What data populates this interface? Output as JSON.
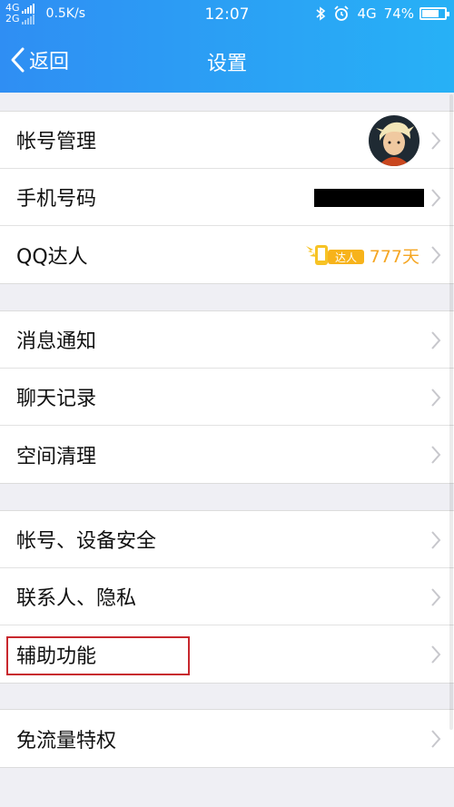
{
  "status_bar": {
    "net_top": "4G",
    "net_bottom": "2G",
    "speed": "0.5K/s",
    "time": "12:07",
    "network": "4G",
    "battery": "74%",
    "battery_level": 0.74,
    "icons": [
      "bluetooth-icon",
      "alarm-icon",
      "battery-icon"
    ]
  },
  "nav": {
    "back_label": "返回",
    "title": "设置"
  },
  "groups": [
    {
      "rows": [
        {
          "label": "帐号管理",
          "accessory": "avatar"
        },
        {
          "label": "手机号码",
          "accessory": "masked-phone"
        },
        {
          "label": "QQ达人",
          "accessory": "daren",
          "badge_text": "达人",
          "days": "777天"
        }
      ]
    },
    {
      "rows": [
        {
          "label": "消息通知"
        },
        {
          "label": "聊天记录"
        },
        {
          "label": "空间清理"
        }
      ]
    },
    {
      "rows": [
        {
          "label": "帐号、设备安全"
        },
        {
          "label": "联系人、隐私"
        },
        {
          "label": "辅助功能",
          "highlighted": true
        }
      ]
    },
    {
      "rows": [
        {
          "label": "免流量特权"
        }
      ]
    }
  ],
  "colors": {
    "header_start": "#2f8ef3",
    "header_end": "#27b1f6",
    "highlight_border": "#c8282e",
    "daren_gold": "#f5a623"
  }
}
